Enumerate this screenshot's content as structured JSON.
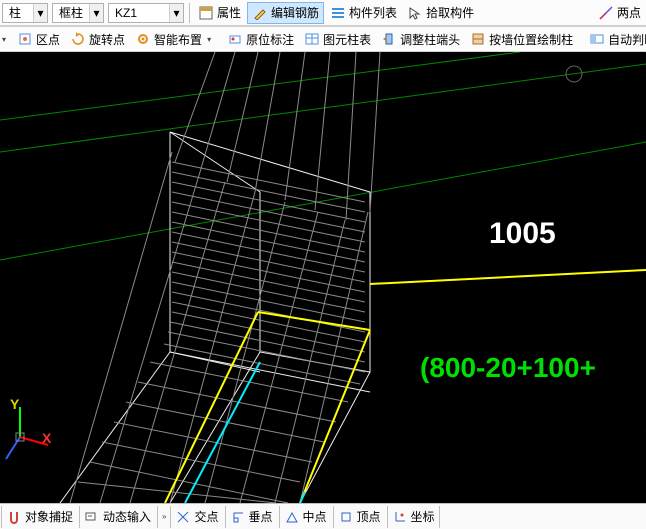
{
  "toolbar1": {
    "combo1": "柱",
    "combo2": "框柱",
    "combo3": "KZ1",
    "btn_attr": "属性",
    "btn_editrebar": "编辑钢筋",
    "btn_list": "构件列表",
    "btn_pick": "拾取构件",
    "btn_twopoint": "两点"
  },
  "toolbar2": {
    "btn_area": "区点",
    "btn_rotate": "旋转点",
    "btn_smart": "智能布置",
    "btn_orig": "原位标注",
    "btn_coltable": "图元柱表",
    "btn_adjust": "调整柱端头",
    "btn_wall": "按墙位置绘制柱",
    "btn_auto": "自动判断"
  },
  "canvas": {
    "dim1": "1005",
    "expr": "(800-20+100+",
    "axis_y": "Y",
    "axis_x": "X"
  },
  "statusbar": {
    "btn_snap": "对象捕捉",
    "btn_dyn": "动态输入",
    "btn_inter": "交点",
    "btn_perp": "垂点",
    "btn_mid": "中点",
    "btn_apex": "顶点",
    "btn_coord": "坐标"
  }
}
